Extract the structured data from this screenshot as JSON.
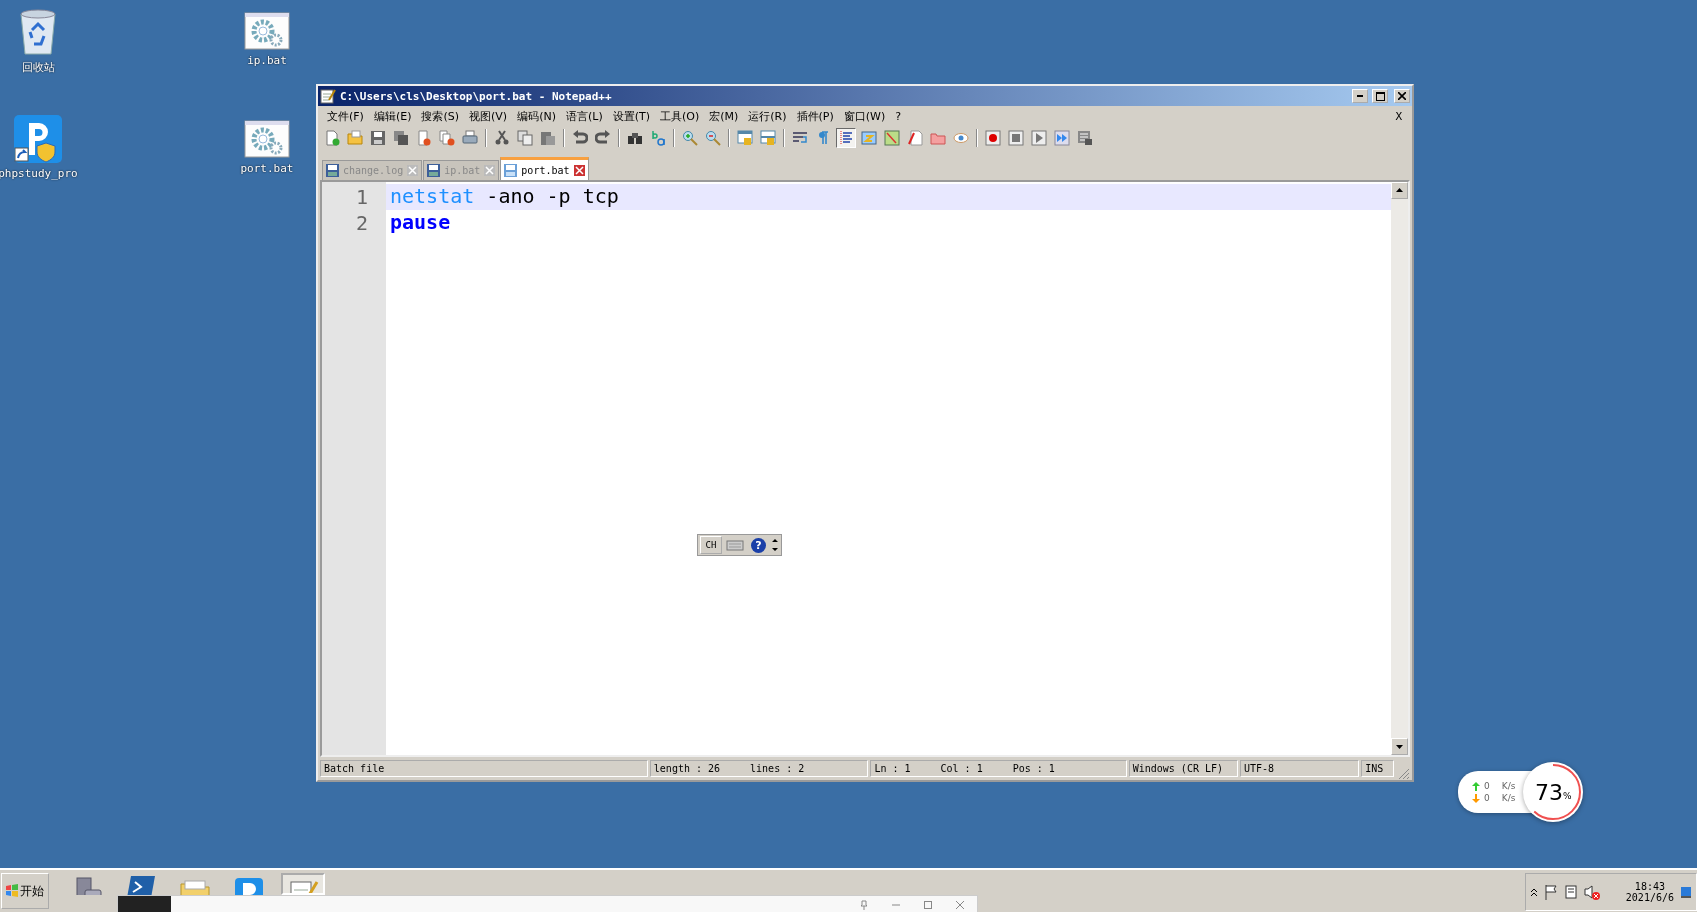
{
  "desktop_icons": [
    {
      "label": "回收站",
      "kind": "recycle"
    },
    {
      "label": "ip.bat",
      "kind": "batch"
    },
    {
      "label": "phpstudy_pro",
      "kind": "app"
    },
    {
      "label": "port.bat",
      "kind": "batch"
    }
  ],
  "window": {
    "title": "C:\\Users\\cls\\Desktop\\port.bat - Notepad++"
  },
  "menu": [
    "文件(F)",
    "编辑(E)",
    "搜索(S)",
    "视图(V)",
    "编码(N)",
    "语言(L)",
    "设置(T)",
    "工具(O)",
    "宏(M)",
    "运行(R)",
    "插件(P)",
    "窗口(W)",
    "?"
  ],
  "menu_close": "X",
  "toolbar": [
    {
      "kind": "new",
      "pressed": false
    },
    {
      "kind": "open",
      "pressed": false
    },
    {
      "kind": "save",
      "pressed": false
    },
    {
      "kind": "saveall",
      "pressed": false
    },
    {
      "kind": "close",
      "pressed": false
    },
    {
      "kind": "closeall",
      "pressed": false
    },
    {
      "kind": "print",
      "pressed": false
    },
    {
      "kind": "sep"
    },
    {
      "kind": "cut",
      "pressed": false
    },
    {
      "kind": "copy",
      "pressed": false
    },
    {
      "kind": "paste",
      "pressed": false
    },
    {
      "kind": "sep"
    },
    {
      "kind": "undo",
      "pressed": false
    },
    {
      "kind": "redo",
      "pressed": false
    },
    {
      "kind": "sep"
    },
    {
      "kind": "find",
      "pressed": false
    },
    {
      "kind": "replace",
      "pressed": false
    },
    {
      "kind": "sep"
    },
    {
      "kind": "zoomin",
      "pressed": false
    },
    {
      "kind": "zoomout",
      "pressed": false
    },
    {
      "kind": "sep"
    },
    {
      "kind": "syncv",
      "pressed": false
    },
    {
      "kind": "synch",
      "pressed": false
    },
    {
      "kind": "sep"
    },
    {
      "kind": "wrap",
      "pressed": false
    },
    {
      "kind": "pilcrow",
      "pressed": false
    },
    {
      "kind": "indent",
      "pressed": true
    },
    {
      "kind": "lang",
      "pressed": false
    },
    {
      "kind": "map",
      "pressed": false
    },
    {
      "kind": "func",
      "pressed": false
    },
    {
      "kind": "folder",
      "pressed": false
    },
    {
      "kind": "monitor",
      "pressed": false
    },
    {
      "kind": "sep"
    },
    {
      "kind": "record",
      "pressed": false
    },
    {
      "kind": "stop",
      "pressed": false
    },
    {
      "kind": "play",
      "pressed": false
    },
    {
      "kind": "playmulti",
      "pressed": false
    },
    {
      "kind": "savemacro",
      "pressed": false
    }
  ],
  "tabs": [
    {
      "label": "change.log",
      "selected": false
    },
    {
      "label": "ip.bat",
      "selected": false
    },
    {
      "label": "port.bat",
      "selected": true
    }
  ],
  "editor": {
    "lines": [
      {
        "number": "1",
        "current": true,
        "tokens": [
          {
            "text": "netstat",
            "kind": "command"
          },
          {
            "text": " -ano -p tcp",
            "kind": "plain"
          }
        ]
      },
      {
        "number": "2",
        "current": false,
        "tokens": [
          {
            "text": "pause",
            "kind": "keyword"
          }
        ]
      }
    ]
  },
  "status_bar": [
    [
      "Batch file"
    ],
    [
      "length : 26",
      "lines : 2"
    ],
    [
      "Ln : 1",
      "Col : 1",
      "Pos : 1"
    ],
    [
      "Windows (CR LF)"
    ],
    [
      "UTF-8"
    ],
    [
      "INS"
    ]
  ],
  "ime_bar": {
    "label": "CH",
    "help": "?"
  },
  "network_widget": {
    "upload": "0",
    "upload_unit": "K/s",
    "download": "0",
    "download_unit": "K/s",
    "percent": "73",
    "percent_sign": "%"
  },
  "taskbar": {
    "start": "开始",
    "buttons": [
      {
        "kind": "server",
        "selected": false
      },
      {
        "kind": "powershell",
        "selected": false
      },
      {
        "kind": "explorer",
        "selected": false
      },
      {
        "kind": "phpstudy",
        "selected": false
      },
      {
        "kind": "notepad",
        "selected": true
      }
    ],
    "clock": {
      "time": "18:43",
      "date": "2021/6/6"
    }
  }
}
